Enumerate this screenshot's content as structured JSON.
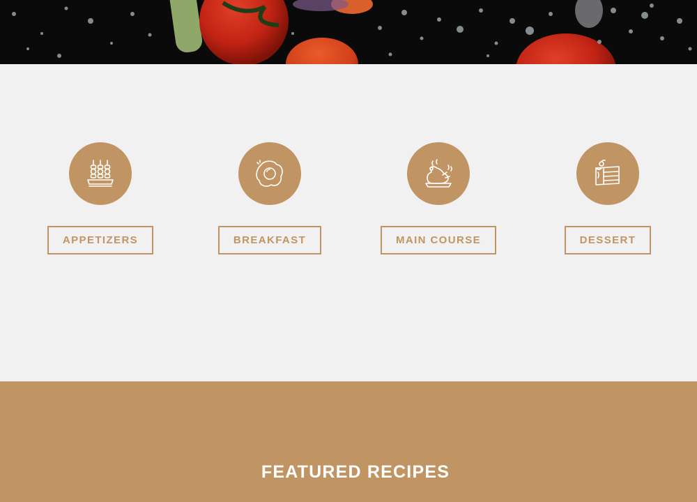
{
  "hero": {
    "image": "tomatoes-and-water-drops-photo"
  },
  "categories": [
    {
      "label": "APPETIZERS",
      "icon": "skewers-icon"
    },
    {
      "label": "BREAKFAST",
      "icon": "fried-egg-icon"
    },
    {
      "label": "MAIN COURSE",
      "icon": "roast-chicken-icon"
    },
    {
      "label": "DESSERT",
      "icon": "cake-slice-icon"
    }
  ],
  "featured": {
    "title": "FEATURED RECIPES"
  },
  "colors": {
    "accent": "#c09563",
    "section_bg": "#f1f1f1",
    "hero_bg": "#0b0b0b",
    "white": "#ffffff"
  }
}
